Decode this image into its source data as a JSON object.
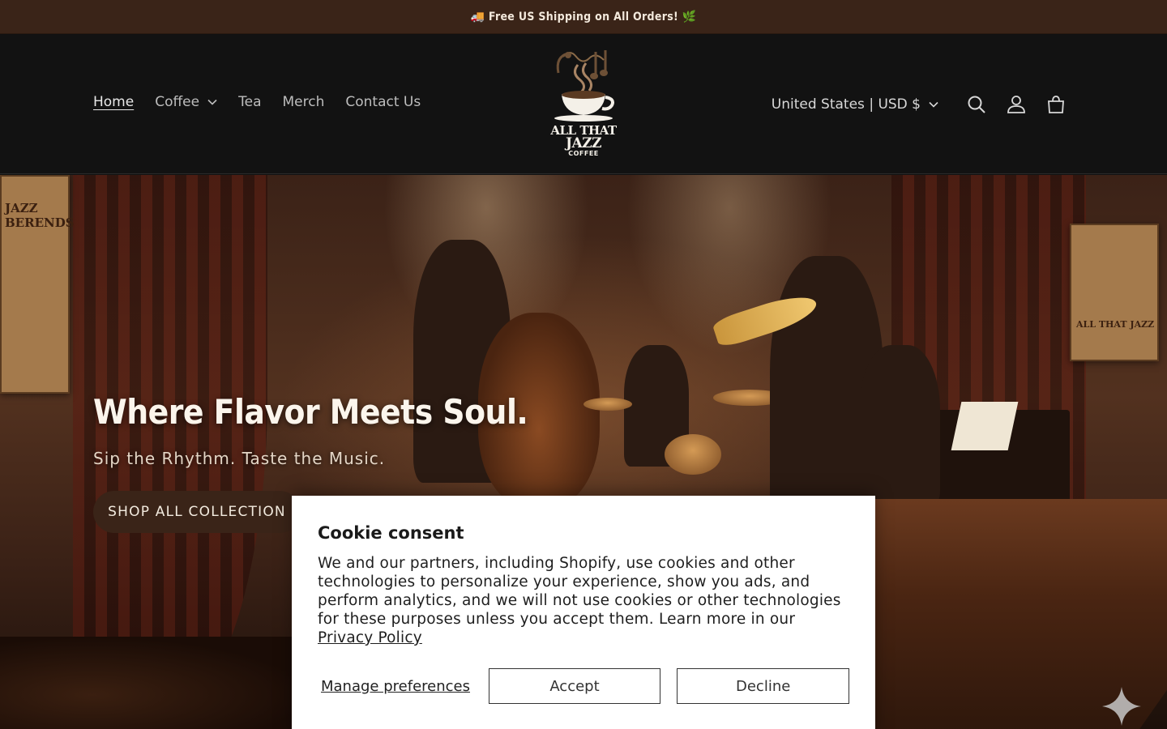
{
  "announcement": {
    "text": "🚚 Free US Shipping on All Orders! 🌿"
  },
  "nav": {
    "items": [
      {
        "label": "Home",
        "active": true,
        "dropdown": false
      },
      {
        "label": "Coffee",
        "active": false,
        "dropdown": true
      },
      {
        "label": "Tea",
        "active": false,
        "dropdown": false
      },
      {
        "label": "Merch",
        "active": false,
        "dropdown": false
      },
      {
        "label": "Contact Us",
        "active": false,
        "dropdown": false
      }
    ]
  },
  "logo": {
    "line1": "ALL THAT",
    "line2": "JAZZ",
    "line3": "COFFEE"
  },
  "header": {
    "country_selector": "United States | USD $",
    "icons": [
      "search-icon",
      "account-icon",
      "cart-icon"
    ]
  },
  "hero": {
    "title": "Where Flavor Meets Soul.",
    "subtitle": "Sip the Rhythm. Taste the Music.",
    "cta_label": "SHOP ALL COLLECTION",
    "poster_left_text": "JAZZ BERENDS",
    "poster_right_text": "ALL THAT JAZZ"
  },
  "cookie": {
    "title": "Cookie consent",
    "body": "We and our partners, including Shopify, use cookies and other technologies to personalize your experience, show you ads, and perform analytics, and we will not use cookies or other technologies for these purposes unless you accept them. Learn more in our ",
    "privacy_link": "Privacy Policy",
    "manage_label": "Manage preferences",
    "accept_label": "Accept",
    "decline_label": "Decline"
  },
  "colors": {
    "announcement_bg": "#3a2418",
    "header_bg": "#121212",
    "cta_bg": "#3a2418"
  }
}
